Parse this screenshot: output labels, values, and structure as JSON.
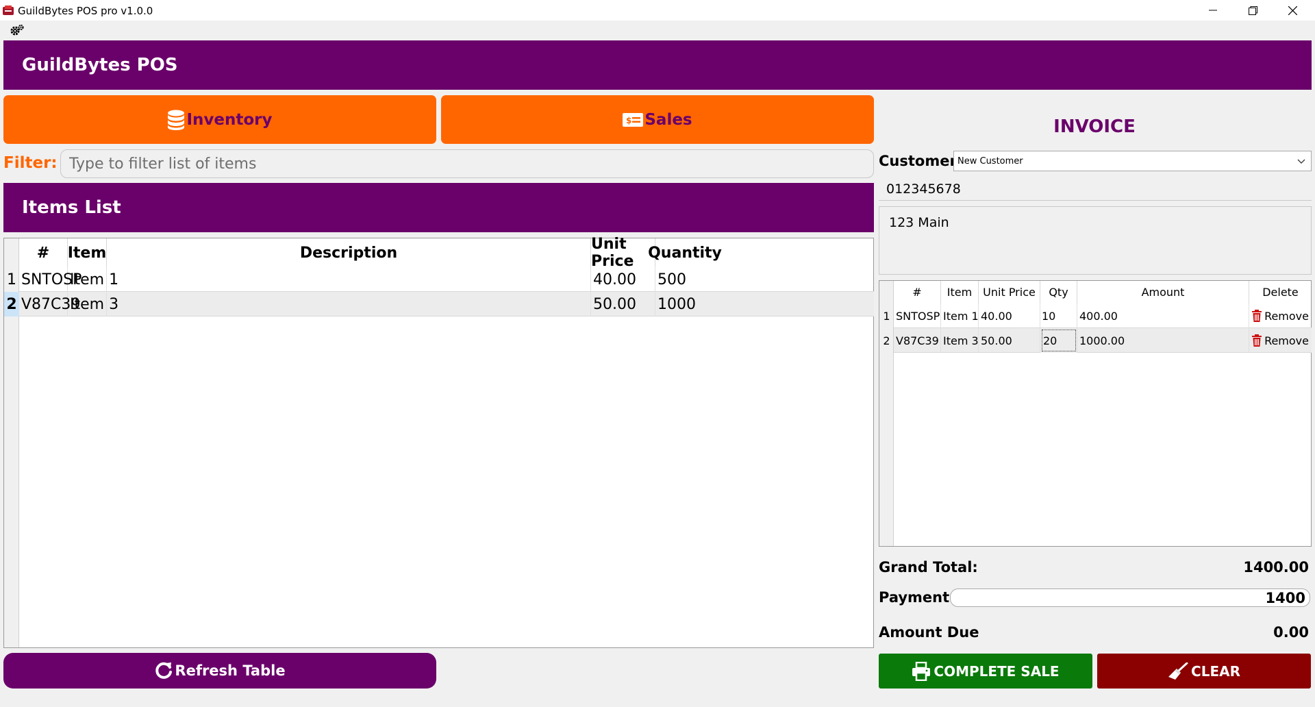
{
  "window": {
    "title": "GuildBytes POS pro v1.0.0",
    "app_icon": "app-logo-icon",
    "controls": [
      "minimize-icon",
      "restore-icon",
      "close-icon"
    ]
  },
  "toolbar": {
    "settings_icon": "gear-icon"
  },
  "header": {
    "title": "GuildBytes POS"
  },
  "nav": {
    "inventory_label": "Inventory",
    "inventory_icon": "database-icon",
    "sales_label": "Sales",
    "sales_icon": "money-icon"
  },
  "filter": {
    "label": "Filter:",
    "placeholder": "Type to filter list of items",
    "value": ""
  },
  "items_list": {
    "title": "Items List",
    "columns": [
      "#",
      "Item",
      "Description",
      "Unit Price",
      "Quantity"
    ],
    "rows": [
      {
        "row": "1",
        "code": "SNTOSP",
        "item": "Item 1",
        "description": "",
        "unit_price": "40.00",
        "quantity": "500"
      },
      {
        "row": "2",
        "code": "V87C39",
        "item": "Item 3",
        "description": "",
        "unit_price": "50.00",
        "quantity": "1000"
      }
    ],
    "refresh_label": "Refresh Table",
    "refresh_icon": "refresh-icon"
  },
  "invoice": {
    "title": "INVOICE",
    "customer_label": "Customer:",
    "customer_value": "New Customer",
    "phone": "012345678",
    "address": "123 Main",
    "columns": [
      "#",
      "Item",
      "Unit Price",
      "Qty",
      "Amount",
      "Delete"
    ],
    "rows": [
      {
        "row": "1",
        "code": "SNTOSP",
        "item": "Item 1",
        "unit_price": "40.00",
        "qty": "10",
        "amount": "400.00",
        "delete_label": "Remove"
      },
      {
        "row": "2",
        "code": "V87C39",
        "item": "Item 3",
        "unit_price": "50.00",
        "qty": "20",
        "amount": "1000.00",
        "delete_label": "Remove"
      }
    ],
    "grand_total_label": "Grand Total:",
    "grand_total_value": "1400.00",
    "payment_label": "Payment:",
    "payment_value": "1400",
    "amount_due_label": "Amount Due",
    "amount_due_value": "0.00",
    "complete_label": "COMPLETE SALE",
    "complete_icon": "printer-icon",
    "clear_label": "CLEAR",
    "clear_icon": "broom-icon"
  },
  "colors": {
    "brand_purple": "#6a006a",
    "accent_orange": "#ff6600",
    "success_green": "#0a7a0a",
    "danger_red": "#8b0000",
    "remove_icon_red": "#cc1111"
  }
}
